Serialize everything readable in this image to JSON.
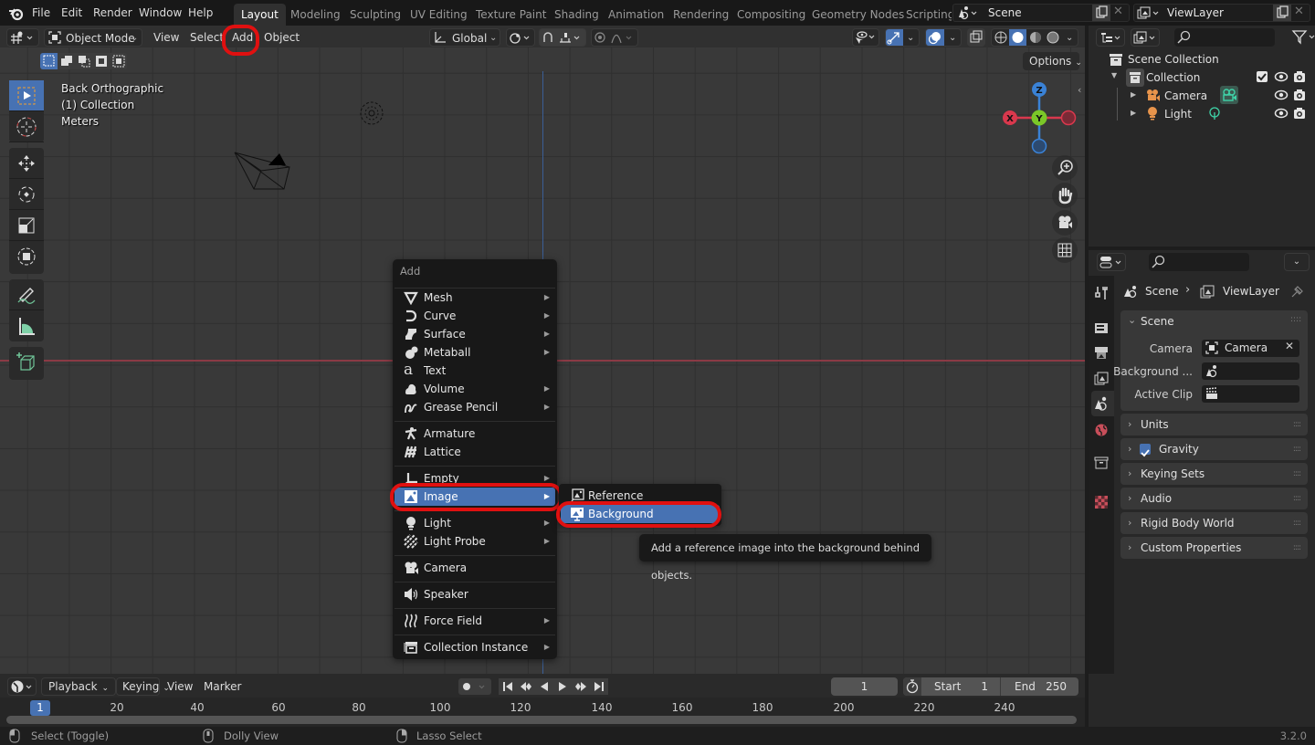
{
  "topbar": {
    "menus": [
      "File",
      "Edit",
      "Render",
      "Window",
      "Help"
    ],
    "workspaces": [
      "Layout",
      "Modeling",
      "Sculpting",
      "UV Editing",
      "Texture Paint",
      "Shading",
      "Animation",
      "Rendering",
      "Compositing",
      "Geometry Nodes",
      "Scripting"
    ],
    "active_workspace": "Layout",
    "scene_name": "Scene",
    "view_layer_name": "ViewLayer"
  },
  "viewport_header": {
    "mode": "Object Mode",
    "menus": [
      "View",
      "Select",
      "Add",
      "Object"
    ],
    "transform_orientation": "Global",
    "options_label": "Options"
  },
  "viewport": {
    "overlay_lines": [
      "Back Orthographic",
      "(1) Collection",
      "Meters"
    ],
    "gizmo_axes": {
      "x": "X",
      "y": "Y",
      "z": "Z"
    },
    "colors": {
      "x_axis": "#d9384d",
      "y_axis": "#7bc728",
      "z_axis": "#3a82d6",
      "selected": "#4772b3",
      "annotation": "#e01010"
    }
  },
  "add_menu": {
    "title": "Add",
    "items": [
      {
        "label": "Mesh",
        "submenu": true,
        "icon": "mesh-icon"
      },
      {
        "label": "Curve",
        "submenu": true,
        "icon": "curve-icon"
      },
      {
        "label": "Surface",
        "submenu": true,
        "icon": "surface-icon"
      },
      {
        "label": "Metaball",
        "submenu": true,
        "icon": "metaball-icon"
      },
      {
        "label": "Text",
        "submenu": false,
        "icon": "text-icon"
      },
      {
        "label": "Volume",
        "submenu": true,
        "icon": "volume-icon"
      },
      {
        "label": "Grease Pencil",
        "submenu": true,
        "icon": "grease-pencil-icon"
      },
      {
        "label": "Armature",
        "submenu": false,
        "icon": "armature-icon"
      },
      {
        "label": "Lattice",
        "submenu": false,
        "icon": "lattice-icon"
      },
      {
        "label": "Empty",
        "submenu": true,
        "icon": "empty-icon"
      },
      {
        "label": "Image",
        "submenu": true,
        "icon": "image-icon",
        "highlighted": true
      },
      {
        "label": "Light",
        "submenu": true,
        "icon": "light-icon"
      },
      {
        "label": "Light Probe",
        "submenu": true,
        "icon": "light-probe-icon"
      },
      {
        "label": "Camera",
        "submenu": false,
        "icon": "camera-icon"
      },
      {
        "label": "Speaker",
        "submenu": false,
        "icon": "speaker-icon"
      },
      {
        "label": "Force Field",
        "submenu": true,
        "icon": "force-field-icon"
      },
      {
        "label": "Collection Instance",
        "submenu": true,
        "icon": "collection-instance-icon"
      }
    ],
    "image_submenu": [
      {
        "label": "Reference"
      },
      {
        "label": "Background",
        "highlighted": true
      }
    ],
    "tooltip": "Add a reference image into the background behind objects."
  },
  "outliner": {
    "root": "Scene Collection",
    "collection": "Collection",
    "objects": [
      {
        "name": "Camera"
      },
      {
        "name": "Light"
      }
    ]
  },
  "properties": {
    "breadcrumb": [
      "Scene",
      "ViewLayer"
    ],
    "scene_panel": {
      "title": "Scene",
      "fields": [
        {
          "label": "Camera",
          "value": "Camera"
        },
        {
          "label": "Background ...",
          "value": ""
        },
        {
          "label": "Active Clip",
          "value": ""
        }
      ]
    },
    "panels": [
      "Units",
      "Gravity",
      "Keying Sets",
      "Audio",
      "Rigid Body World",
      "Custom Properties"
    ],
    "gravity_checked": true
  },
  "timeline": {
    "menus": [
      "Playback",
      "Keying",
      "View",
      "Marker"
    ],
    "current_frame": "1",
    "start_label": "Start",
    "start": "1",
    "end_label": "End",
    "end": "250",
    "ticks": [
      "1",
      "20",
      "40",
      "60",
      "80",
      "100",
      "120",
      "140",
      "160",
      "180",
      "200",
      "220",
      "240"
    ]
  },
  "statusbar": {
    "hints": [
      "Select (Toggle)",
      "Dolly View",
      "Lasso Select"
    ],
    "version": "3.2.0"
  }
}
